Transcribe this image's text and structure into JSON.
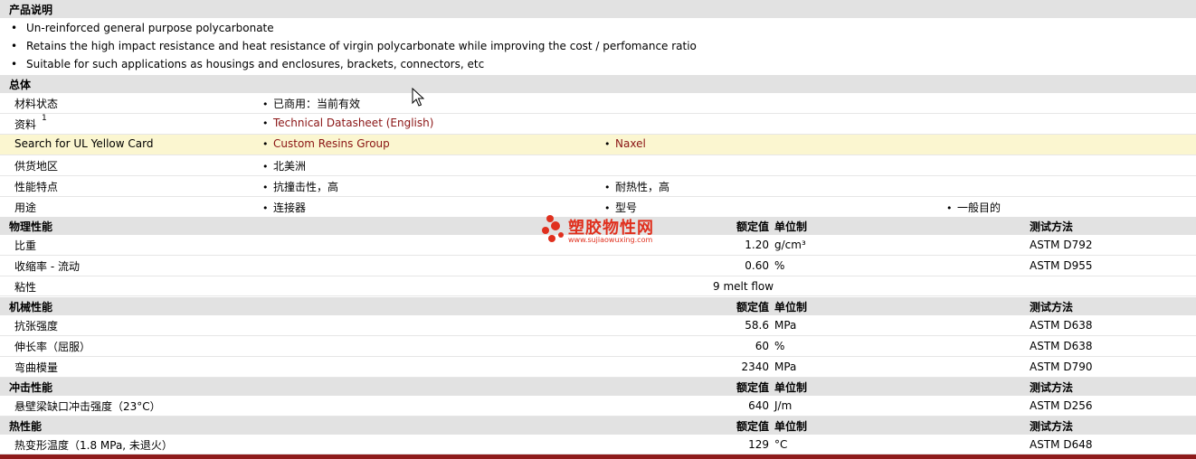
{
  "description": {
    "title": "产品说明",
    "bullets": [
      "Un-reinforced general purpose polycarbonate",
      "Retains the high impact resistance and heat resistance of virgin polycarbonate while improving the cost / perfomance ratio",
      "Suitable for such applications as housings and enclosures, brackets, connectors, etc"
    ]
  },
  "general": {
    "title": "总体",
    "rows": [
      {
        "label": "材料状态",
        "sup": "",
        "cols": [
          "已商用：当前有效"
        ],
        "links": false,
        "highlight": false
      },
      {
        "label": "资料",
        "sup": "1",
        "cols": [
          "Technical Datasheet (English)"
        ],
        "links": true,
        "highlight": false
      },
      {
        "label": "Search for UL Yellow Card",
        "sup": "",
        "cols": [
          "Custom Resins Group",
          "Naxel"
        ],
        "links": true,
        "highlight": true
      },
      {
        "label": "供货地区",
        "sup": "",
        "cols": [
          "北美洲"
        ],
        "links": false,
        "highlight": false
      },
      {
        "label": "性能特点",
        "sup": "",
        "cols": [
          "抗撞击性，高",
          "耐热性，高"
        ],
        "links": false,
        "highlight": false
      },
      {
        "label": "用途",
        "sup": "",
        "cols": [
          "连接器",
          "型号",
          "一般目的"
        ],
        "links": false,
        "highlight": false
      }
    ]
  },
  "headers": {
    "value": "额定值",
    "unit": "单位制",
    "method": "测试方法"
  },
  "physical": {
    "title": "物理性能",
    "rows": [
      {
        "label": "比重",
        "value": "1.20",
        "unit": "g/cm³",
        "method": "ASTM D792"
      },
      {
        "label": "收缩率  - 流动",
        "value": "0.60",
        "unit": "%",
        "method": "ASTM D955"
      },
      {
        "label": "粘性",
        "value_combined": "9 melt flow"
      }
    ]
  },
  "mechanical": {
    "title": "机械性能",
    "rows": [
      {
        "label": "抗张强度",
        "value": "58.6",
        "unit": "MPa",
        "method": "ASTM D638"
      },
      {
        "label": "伸长率（屈服）",
        "value": "60",
        "unit": "%",
        "method": "ASTM D638"
      },
      {
        "label": "弯曲模量",
        "value": "2340",
        "unit": "MPa",
        "method": "ASTM D790"
      }
    ]
  },
  "impact": {
    "title": "冲击性能",
    "rows": [
      {
        "label": "悬壁梁缺口冲击强度（23°C）",
        "value": "640",
        "unit": "J/m",
        "method": "ASTM D256"
      }
    ]
  },
  "thermal": {
    "title": "热性能",
    "rows": [
      {
        "label": "热变形温度（1.8 MPa, 未退火）",
        "value": "129",
        "unit": "°C",
        "method": "ASTM D648"
      }
    ]
  },
  "watermark": {
    "name": "塑胶物性网",
    "url": "www.sujiaowuxing.com"
  },
  "colors": {
    "link": "#8a1414",
    "section_bg": "#e2e2e2",
    "highlight_bg": "#fbf6d0",
    "logo": "#e0301e",
    "bottom_bar": "#8e1b1b"
  }
}
